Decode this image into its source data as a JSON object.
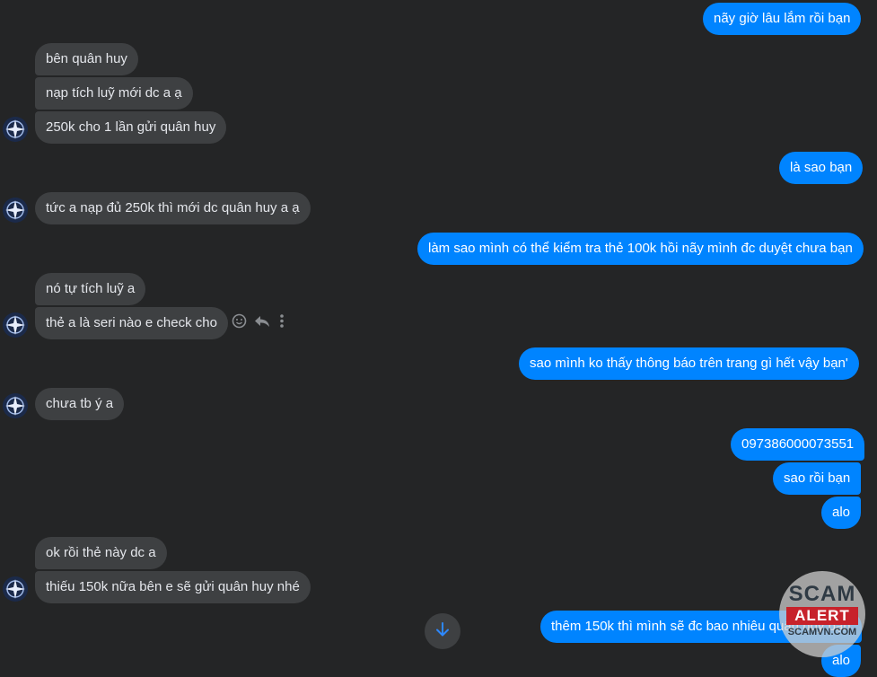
{
  "messages": {
    "out_1": "nãy giờ lâu lắm rồi bạn",
    "in_1": "bên quân huy",
    "in_2": "nạp tích luỹ mới dc a ạ",
    "in_3": "250k cho 1 lần gửi quân huy",
    "out_2": "là sao bạn",
    "in_4": "tức a nạp đủ 250k thì mới dc quân huy a ạ",
    "out_3": "làm sao mình có thể kiểm tra thẻ 100k hồi nãy mình đc duyệt chưa bạn",
    "in_5": "nó tự tích luỹ a",
    "in_6": "thẻ a là seri nào e check cho",
    "out_4": "sao mình ko thấy thông báo trên trang gì hết vậy bạn'",
    "in_7": "chưa tb ý a",
    "out_5": "097386000073551",
    "out_6": "sao rồi bạn",
    "out_7": "alo",
    "in_8": "ok rồi thẻ này dc a",
    "in_9": "thiếu 150k nữa bên e sẽ gửi quân huy nhé",
    "out_8": "thêm 150k thì mình sẽ đc bao nhiêu quân huy bạn",
    "out_9": "alo"
  },
  "message_actions": {
    "icons": [
      "smile-icon",
      "reply-icon",
      "more-icon"
    ]
  },
  "watermark": {
    "line1": "SCAM",
    "line2": "ALERT",
    "line3": "SCAMVN.COM"
  },
  "colors": {
    "background": "#242526",
    "incoming_bubble": "#3e4042",
    "outgoing_bubble": "#0084ff",
    "text": "#e4e6eb",
    "watermark_red": "#c7222b"
  }
}
